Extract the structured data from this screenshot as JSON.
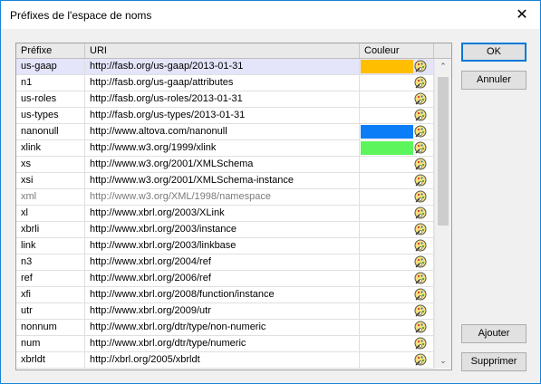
{
  "window": {
    "title": "Préfixes de l'espace de noms"
  },
  "table": {
    "headers": {
      "prefix": "Préfixe",
      "uri": "URI",
      "color": "Couleur"
    },
    "rows": [
      {
        "prefix": "us-gaap",
        "uri": "http://fasb.org/us-gaap/2013-01-31",
        "color": "#ffbe00",
        "selected": true
      },
      {
        "prefix": "n1",
        "uri": "http://fasb.org/us-gaap/attributes",
        "color": ""
      },
      {
        "prefix": "us-roles",
        "uri": "http://fasb.org/us-roles/2013-01-31",
        "color": ""
      },
      {
        "prefix": "us-types",
        "uri": "http://fasb.org/us-types/2013-01-31",
        "color": ""
      },
      {
        "prefix": "nanonull",
        "uri": "http://www.altova.com/nanonull",
        "color": "#0a7df7"
      },
      {
        "prefix": "xlink",
        "uri": "http://www.w3.org/1999/xlink",
        "color": "#5cf55c"
      },
      {
        "prefix": "xs",
        "uri": "http://www.w3.org/2001/XMLSchema",
        "color": ""
      },
      {
        "prefix": "xsi",
        "uri": "http://www.w3.org/2001/XMLSchema-instance",
        "color": ""
      },
      {
        "prefix": "xml",
        "uri": "http://www.w3.org/XML/1998/namespace",
        "color": "",
        "dim": true
      },
      {
        "prefix": "xl",
        "uri": "http://www.xbrl.org/2003/XLink",
        "color": ""
      },
      {
        "prefix": "xbrli",
        "uri": "http://www.xbrl.org/2003/instance",
        "color": ""
      },
      {
        "prefix": "link",
        "uri": "http://www.xbrl.org/2003/linkbase",
        "color": ""
      },
      {
        "prefix": "n3",
        "uri": "http://www.xbrl.org/2004/ref",
        "color": ""
      },
      {
        "prefix": "ref",
        "uri": "http://www.xbrl.org/2006/ref",
        "color": ""
      },
      {
        "prefix": "xfi",
        "uri": "http://www.xbrl.org/2008/function/instance",
        "color": ""
      },
      {
        "prefix": "utr",
        "uri": "http://www.xbrl.org/2009/utr",
        "color": ""
      },
      {
        "prefix": "nonnum",
        "uri": "http://www.xbrl.org/dtr/type/non-numeric",
        "color": ""
      },
      {
        "prefix": "num",
        "uri": "http://www.xbrl.org/dtr/type/numeric",
        "color": ""
      },
      {
        "prefix": "xbrldt",
        "uri": "http://xbrl.org/2005/xbrldt",
        "color": ""
      }
    ]
  },
  "buttons": {
    "ok": "OK",
    "cancel": "Annuler",
    "add": "Ajouter",
    "delete": "Supprimer"
  },
  "icons": {
    "close": "close-icon",
    "picker": "color-picker-icon",
    "scroll_up": "chevron-up-icon",
    "scroll_down": "chevron-down-icon"
  }
}
